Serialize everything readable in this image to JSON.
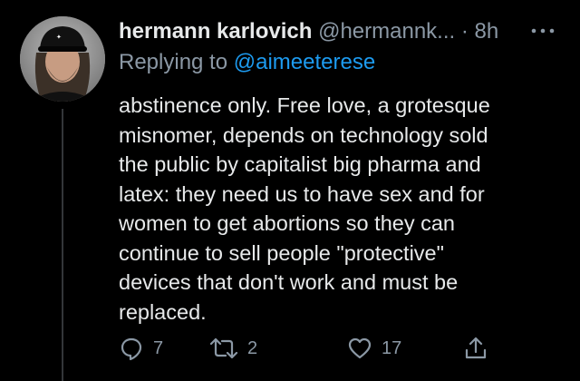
{
  "tweet": {
    "display_name": "hermann karlovich",
    "handle": "@hermannk...",
    "separator": "·",
    "time": "8h",
    "more_icon": "ellipsis-icon",
    "reply_prefix": "Replying to",
    "reply_to": "@aimeeterese",
    "body_lines": [
      "abstinence only. Free love, a grotesque",
      "misnomer, depends on technology sold",
      "the public by capitalist big pharma and",
      "latex: they need us to have sex and for",
      "women to get abortions so they can",
      "continue to sell people \"protective\"",
      "devices that don't work and must be",
      "replaced."
    ],
    "avatar": {
      "icon": "avatar-photo",
      "cap_text": "cap"
    },
    "actions": {
      "reply": {
        "icon": "reply-icon",
        "count": "7"
      },
      "retweet": {
        "icon": "retweet-icon",
        "count": "2"
      },
      "like": {
        "icon": "heart-icon",
        "count": "17"
      },
      "share": {
        "icon": "share-icon"
      }
    }
  },
  "colors": {
    "background": "#000000",
    "text": "#e7e9ea",
    "secondary": "#8b98a5",
    "link": "#1d9bf0",
    "thread_line": "#333639"
  }
}
